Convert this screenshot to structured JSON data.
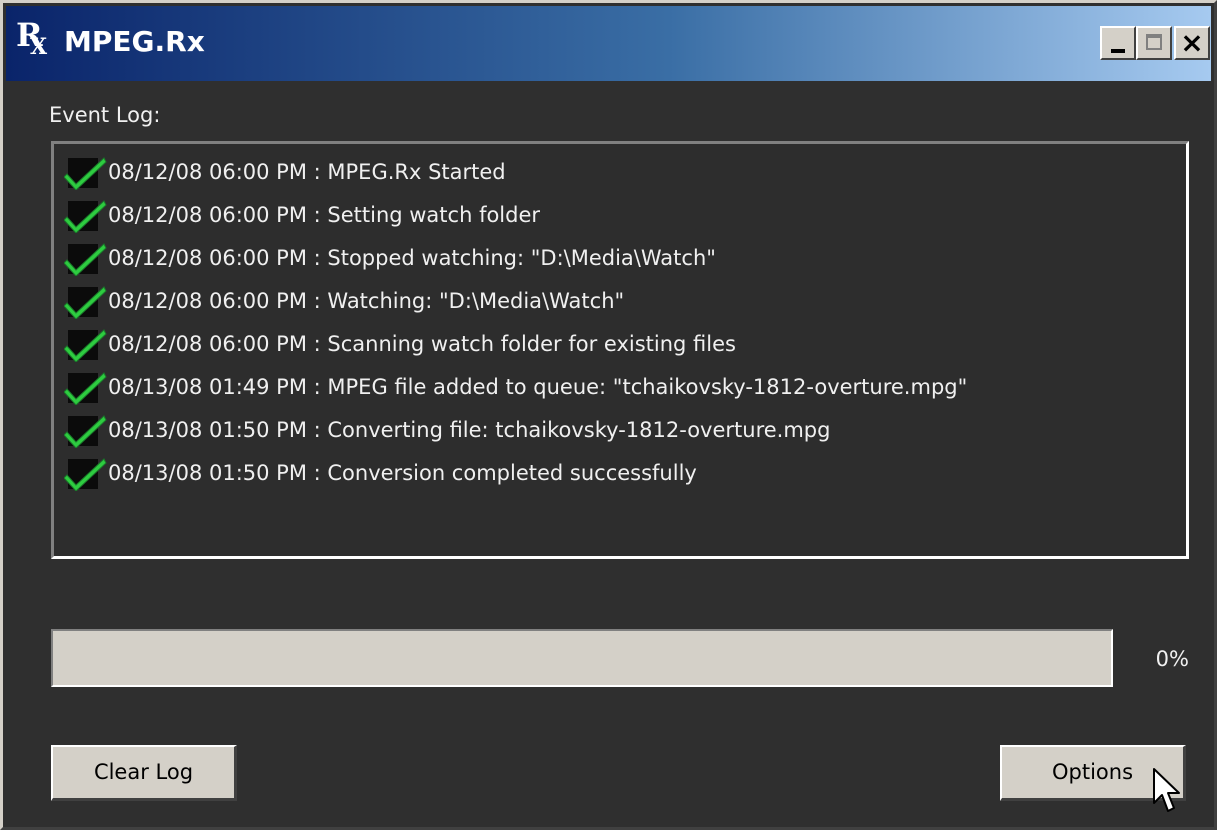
{
  "window": {
    "title": "MPEG.Rx",
    "icon": {
      "letter": "R",
      "sub": "X",
      "name": "rx-app-icon"
    },
    "controls": {
      "minimize": "minimize-icon",
      "maximize": "maximize-icon",
      "close": "close-icon"
    }
  },
  "event_log": {
    "label": "Event Log:",
    "entries": [
      {
        "text": "08/12/08 06:00 PM : MPEG.Rx Started",
        "status": "success",
        "icon": "checkmark-icon"
      },
      {
        "text": "08/12/08 06:00 PM : Setting watch folder",
        "status": "success",
        "icon": "checkmark-icon"
      },
      {
        "text": "08/12/08 06:00 PM : Stopped watching: \"D:\\Media\\Watch\"",
        "status": "success",
        "icon": "checkmark-icon"
      },
      {
        "text": "08/12/08 06:00 PM : Watching: \"D:\\Media\\Watch\"",
        "status": "success",
        "icon": "checkmark-icon"
      },
      {
        "text": "08/12/08 06:00 PM : Scanning watch folder for existing files",
        "status": "success",
        "icon": "checkmark-icon"
      },
      {
        "text": "08/13/08 01:49 PM : MPEG file added to queue: \"tchaikovsky-1812-overture.mpg\"",
        "status": "success",
        "icon": "checkmark-icon"
      },
      {
        "text": "08/13/08 01:50 PM : Converting file: tchaikovsky-1812-overture.mpg",
        "status": "success",
        "icon": "checkmark-icon"
      },
      {
        "text": "08/13/08 01:50 PM : Conversion completed successfully",
        "status": "success",
        "icon": "checkmark-icon"
      }
    ]
  },
  "progress": {
    "value": 0,
    "label": "0%"
  },
  "buttons": {
    "clear_log": "Clear Log",
    "options": "Options"
  },
  "colors": {
    "titlebar_start": "#0a246a",
    "titlebar_end": "#a6caf0",
    "background": "#2f2f2f",
    "text": "#f0f0f0",
    "check_green": "#2ecc40",
    "button_face": "#d4d0c8"
  }
}
